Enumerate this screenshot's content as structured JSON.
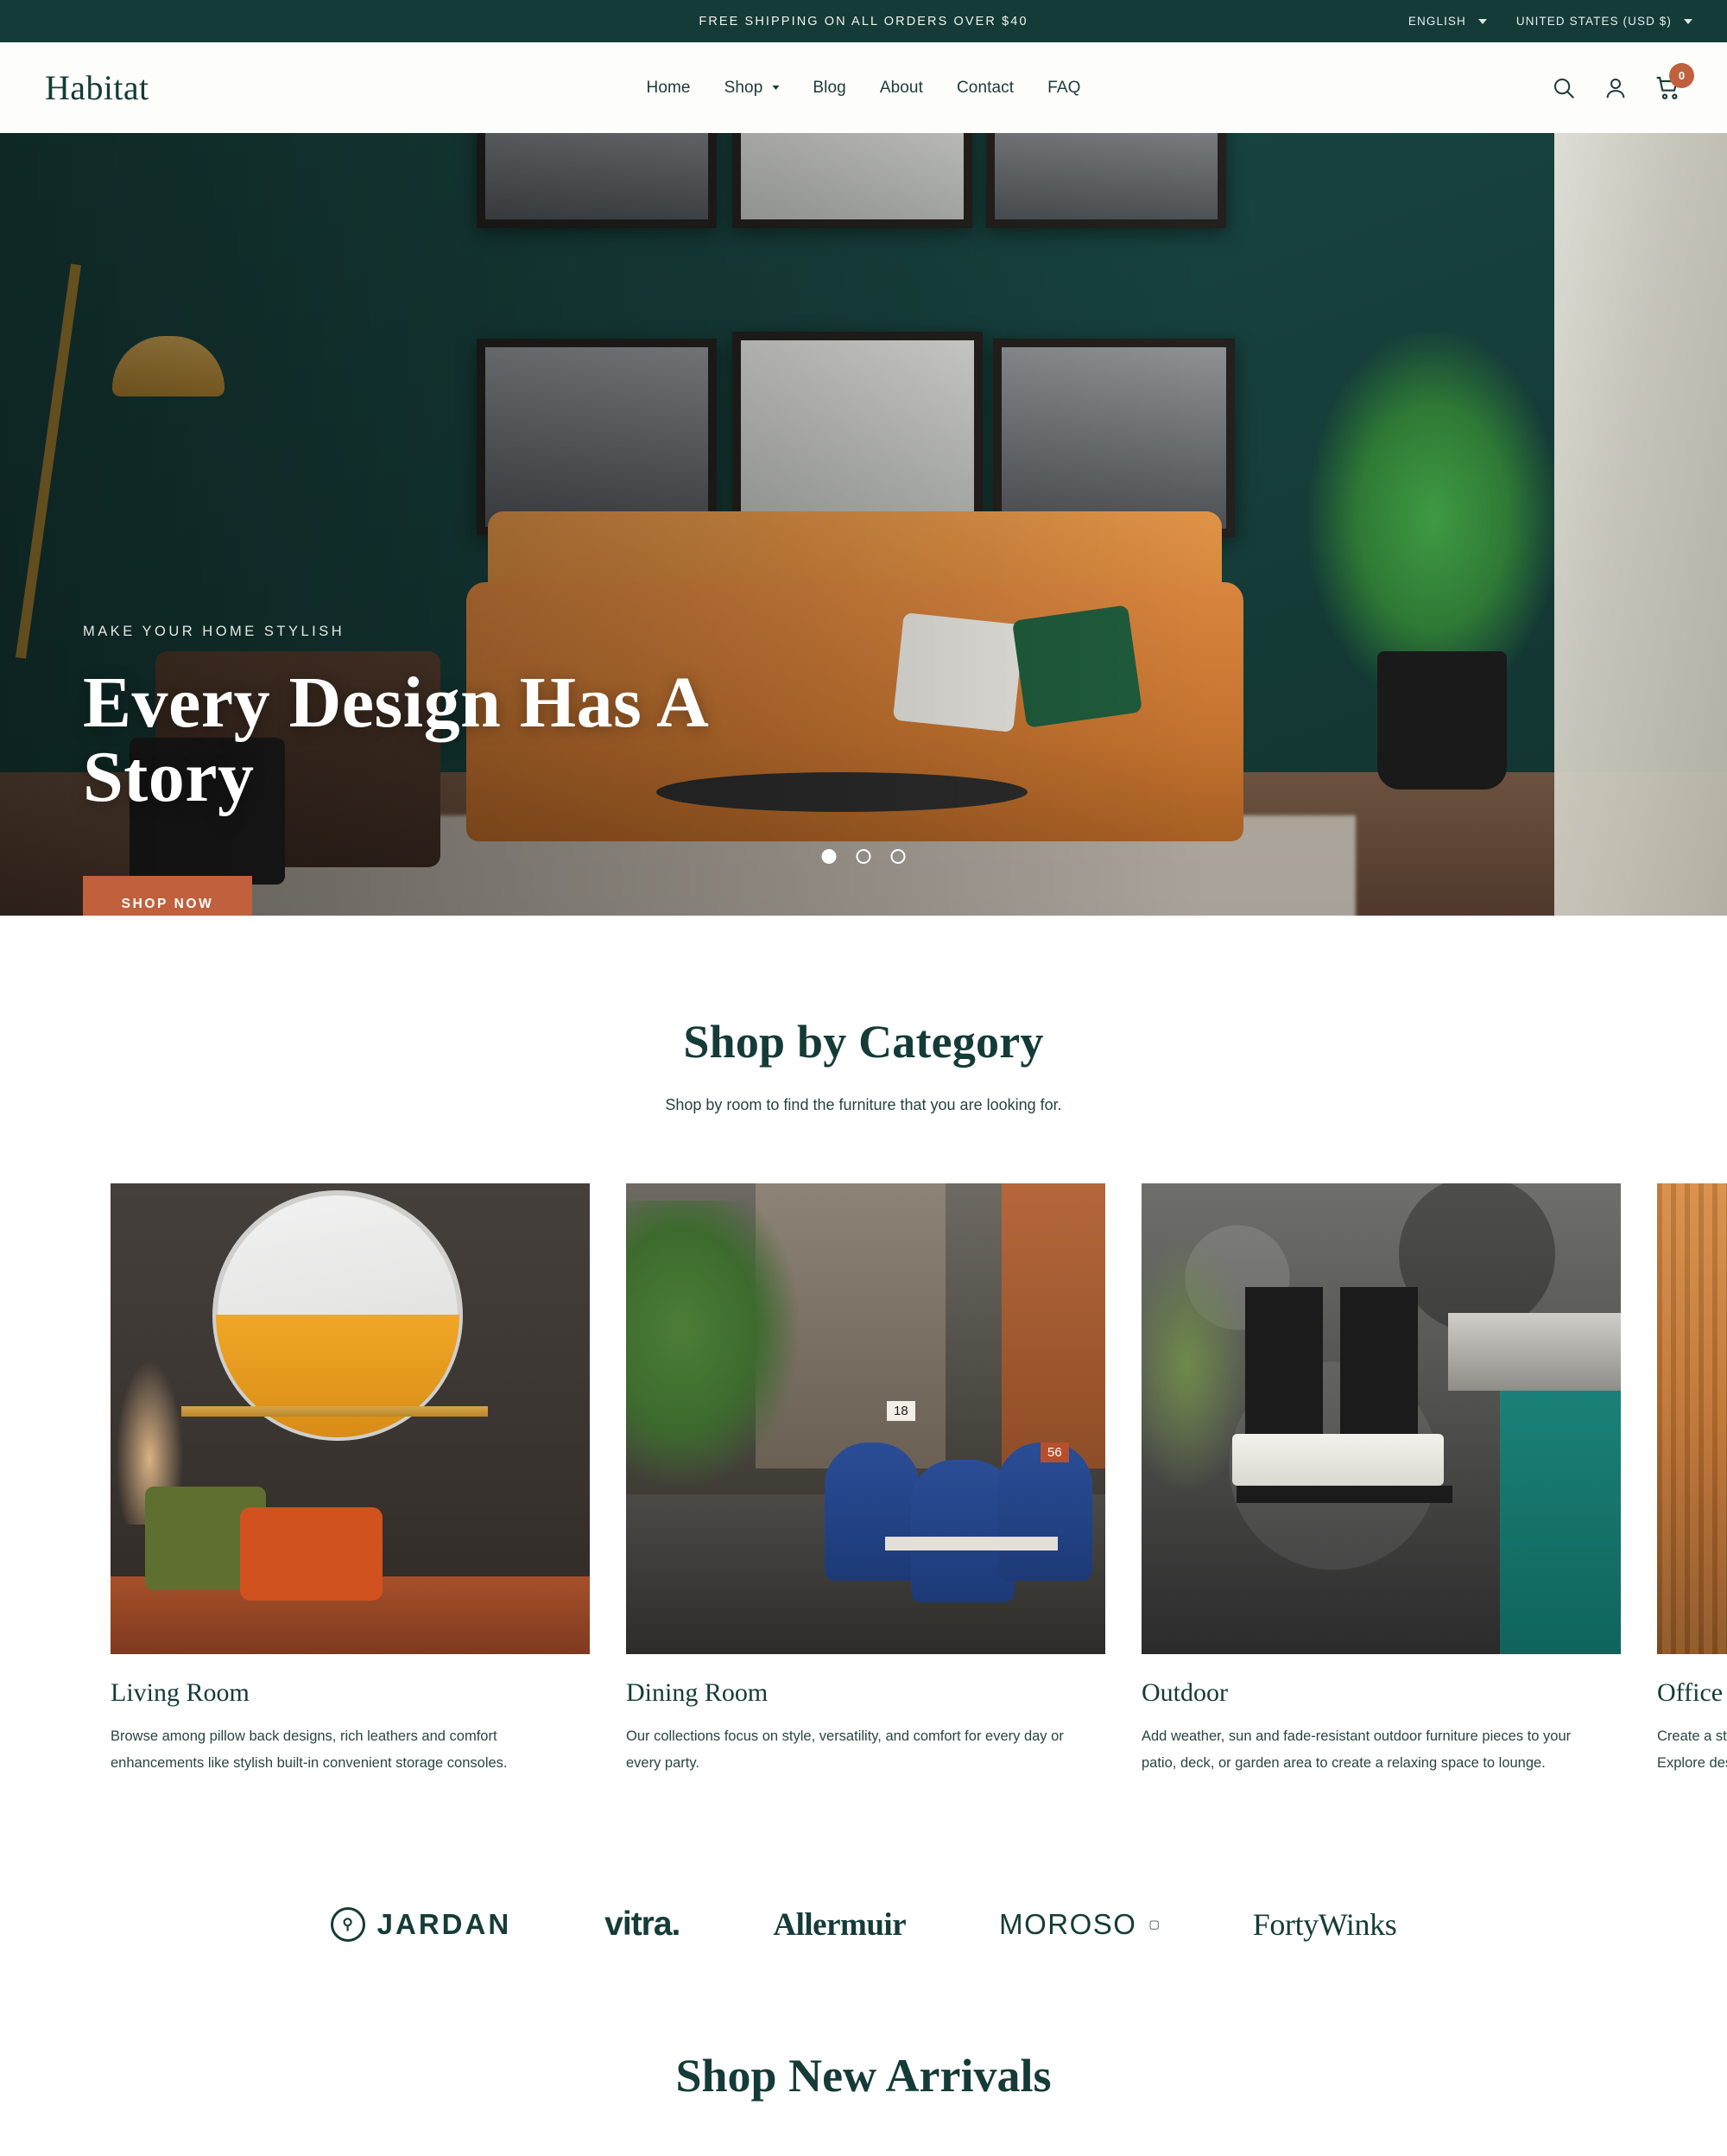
{
  "topbar": {
    "message": "FREE SHIPPING ON ALL ORDERS OVER $40",
    "language": "ENGLISH",
    "country": "UNITED STATES (USD $)"
  },
  "header": {
    "logo": "Habitat",
    "nav": [
      {
        "label": "Home",
        "has_caret": false
      },
      {
        "label": "Shop",
        "has_caret": true
      },
      {
        "label": "Blog",
        "has_caret": false
      },
      {
        "label": "About",
        "has_caret": false
      },
      {
        "label": "Contact",
        "has_caret": false
      },
      {
        "label": "FAQ",
        "has_caret": false
      }
    ],
    "cart_count": "0"
  },
  "hero": {
    "eyebrow": "MAKE YOUR HOME STYLISH",
    "title": "Every Design Has A Story",
    "cta": "SHOP NOW",
    "slide_count": 3,
    "active_slide": 1
  },
  "category_section": {
    "title": "Shop by Category",
    "subtitle": "Shop by room to find the furniture that you are looking for.",
    "cards": [
      {
        "name": "Living Room",
        "desc": "Browse among pillow back designs, rich leathers and comfort enhancements like stylish built-in convenient storage consoles."
      },
      {
        "name": "Dining Room",
        "desc": "Our collections focus on style, versatility, and comfort for every day or every party."
      },
      {
        "name": "Outdoor",
        "desc": "Add weather, sun and fade-resistant outdoor furniture pieces to your patio, deck, or garden area to create a relaxing space to lounge."
      },
      {
        "name": "Office",
        "desc": "Create a stylish home office with ergonomic and modern furniture. Explore desks, chairs and storage."
      }
    ]
  },
  "brands": {
    "items": [
      {
        "name": "JARDAN",
        "mark": "jardan-monogram-icon"
      },
      {
        "name": "vitra.",
        "mark": ""
      },
      {
        "name": "Allermuir",
        "mark": ""
      },
      {
        "name": "MOROSO",
        "mark": "trademark"
      },
      {
        "name": "FortyWinks",
        "mark": ""
      }
    ]
  },
  "arrivals": {
    "title": "Shop New Arrivals"
  },
  "colors": {
    "brand_green": "#143B37",
    "accent_terracotta": "#C0603C",
    "page_bg": "#FFFFFF",
    "header_bg": "#FDFDFB"
  }
}
